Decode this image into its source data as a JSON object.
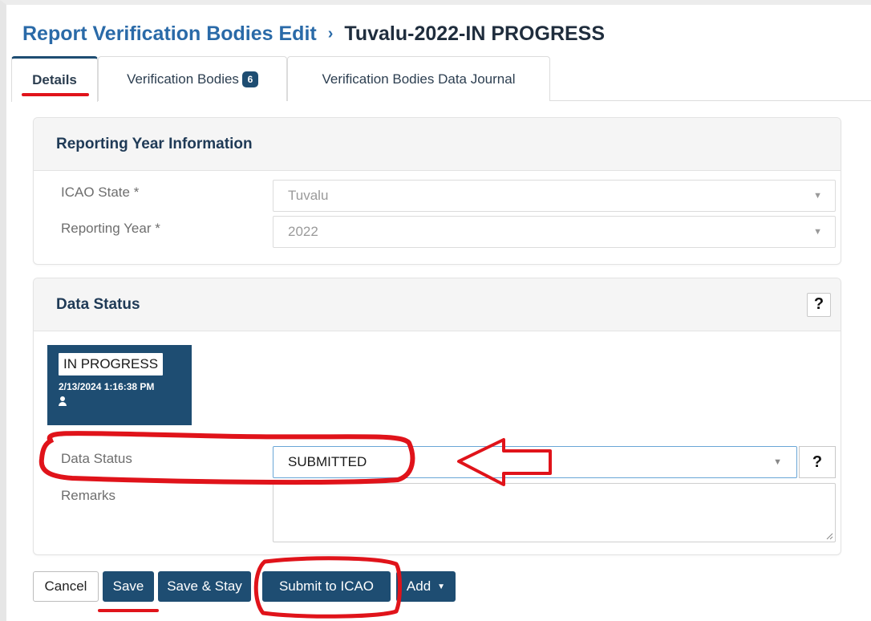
{
  "breadcrumb": {
    "parent": "Report Verification Bodies Edit",
    "separator": "›",
    "current": "Tuvalu-2022-IN PROGRESS"
  },
  "tabs": [
    {
      "label": "Details",
      "active": true
    },
    {
      "label": "Verification Bodies",
      "badge": "6"
    },
    {
      "label": "Verification Bodies Data Journal"
    }
  ],
  "reporting_year_panel": {
    "title": "Reporting Year Information",
    "fields": [
      {
        "label": "ICAO State *",
        "value": "Tuvalu"
      },
      {
        "label": "Reporting Year *",
        "value": "2022"
      }
    ]
  },
  "data_status_panel": {
    "title": "Data Status",
    "help": "?",
    "status_card": {
      "status": "IN PROGRESS",
      "timestamp": "2/13/2024 1:16:38 PM"
    },
    "data_status_label": "Data Status",
    "data_status_value": "SUBMITTED",
    "data_status_help": "?",
    "remarks_label": "Remarks",
    "remarks_value": ""
  },
  "actions": {
    "cancel": "Cancel",
    "save": "Save",
    "save_stay": "Save & Stay",
    "submit": "Submit to ICAO",
    "add": "Add"
  },
  "colors": {
    "primary": "#1e4d72",
    "link": "#2a6aa8",
    "annotation": "#e0131a"
  },
  "icons": {
    "breadcrumb_separator": "chevron-right-icon",
    "select_caret": "caret-down-icon",
    "user": "user-icon"
  }
}
